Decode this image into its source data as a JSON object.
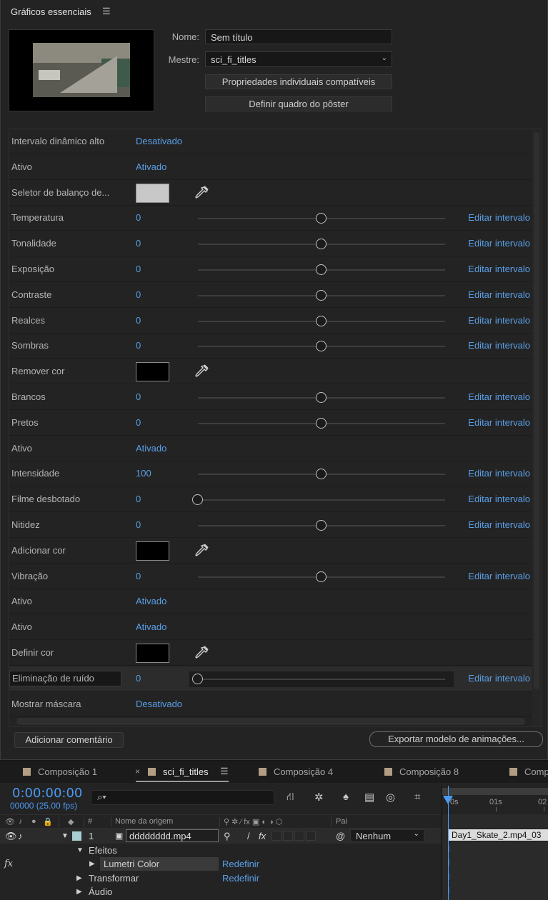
{
  "panel": {
    "title": "Gráficos essenciais",
    "menu_icon": "hamburger-menu-icon",
    "name_label": "Nome:",
    "name_value": "Sem título",
    "master_label": "Mestre:",
    "master_value": "sci_fi_titles",
    "compatible_button": "Propriedades individuais compatíveis",
    "poster_button": "Definir quadro do pôster",
    "add_comment_button": "Adicionar comentário",
    "export_button": "Exportar modelo de animações..."
  },
  "properties": [
    {
      "name": "Intervalo dinâmico alto",
      "kind": "text",
      "value": "Desativado"
    },
    {
      "name": "Ativo",
      "kind": "text",
      "value": "Ativado"
    },
    {
      "name": "Seletor de balanço de...",
      "kind": "color",
      "color": "#c8c8c8"
    },
    {
      "name": "Temperatura",
      "kind": "slider",
      "value": "0",
      "level": 0.5,
      "edit": "Editar intervalo"
    },
    {
      "name": "Tonalidade",
      "kind": "slider",
      "value": "0",
      "level": 0.5,
      "edit": "Editar intervalo"
    },
    {
      "name": "Exposição",
      "kind": "slider",
      "value": "0",
      "level": 0.5,
      "edit": "Editar intervalo"
    },
    {
      "name": "Contraste",
      "kind": "slider",
      "value": "0",
      "level": 0.5,
      "edit": "Editar intervalo"
    },
    {
      "name": "Realces",
      "kind": "slider",
      "value": "0",
      "level": 0.5,
      "edit": "Editar intervalo"
    },
    {
      "name": "Sombras",
      "kind": "slider",
      "value": "0",
      "level": 0.5,
      "edit": "Editar intervalo"
    },
    {
      "name": "Remover cor",
      "kind": "color",
      "color": "#000000"
    },
    {
      "name": "Brancos",
      "kind": "slider",
      "value": "0",
      "level": 0.5,
      "edit": "Editar intervalo"
    },
    {
      "name": "Pretos",
      "kind": "slider",
      "value": "0",
      "level": 0.5,
      "edit": "Editar intervalo"
    },
    {
      "name": "Ativo",
      "kind": "text",
      "value": "Ativado"
    },
    {
      "name": "Intensidade",
      "kind": "slider",
      "value": "100",
      "level": 0.5,
      "edit": "Editar intervalo"
    },
    {
      "name": "Filme desbotado",
      "kind": "slider",
      "value": "0",
      "level": 0.0,
      "edit": "Editar intervalo"
    },
    {
      "name": "Nitidez",
      "kind": "slider",
      "value": "0",
      "level": 0.5,
      "edit": "Editar intervalo"
    },
    {
      "name": "Adicionar cor",
      "kind": "color",
      "color": "#000000"
    },
    {
      "name": "Vibração",
      "kind": "slider",
      "value": "0",
      "level": 0.5,
      "edit": "Editar intervalo"
    },
    {
      "name": "Ativo",
      "kind": "text",
      "value": "Ativado"
    },
    {
      "name": "Ativo",
      "kind": "text",
      "value": "Ativado"
    },
    {
      "name": "Definir cor",
      "kind": "color",
      "color": "#000000"
    },
    {
      "name": "Eliminação de ruído",
      "kind": "slider",
      "value": "0",
      "level": 0.0,
      "edit": "Editar intervalo",
      "selected": true
    },
    {
      "name": "Mostrar máscara",
      "kind": "text",
      "value": "Desativado"
    }
  ],
  "timeline": {
    "tabs": [
      {
        "label": "Composição 1",
        "active": false
      },
      {
        "label": "sci_fi_titles",
        "active": true
      },
      {
        "label": "Composição 4",
        "active": false
      },
      {
        "label": "Composição 8",
        "active": false
      },
      {
        "label": "Comp",
        "active": false
      }
    ],
    "timecode": "0:00:00:00",
    "fps": "00000 (25.00 fps)",
    "search_icon": "search-icon",
    "columns": {
      "hash": "#",
      "source_name": "Nome da origem",
      "parent": "Pai"
    },
    "layer": {
      "number": "1",
      "name": "dddddddd.mp4",
      "parent": "Nenhum"
    },
    "sub_rows": {
      "effects": "Efeitos",
      "lumetri": "Lumetri Color",
      "reset1": "Redefinir",
      "transform": "Transformar",
      "reset2": "Redefinir",
      "audio": "Áudio",
      "fx": "fx"
    },
    "ruler": {
      "t0": "0s",
      "t1": "01s",
      "t2": "02"
    },
    "clip_name": "Day1_Skate_2.mp4_03"
  }
}
